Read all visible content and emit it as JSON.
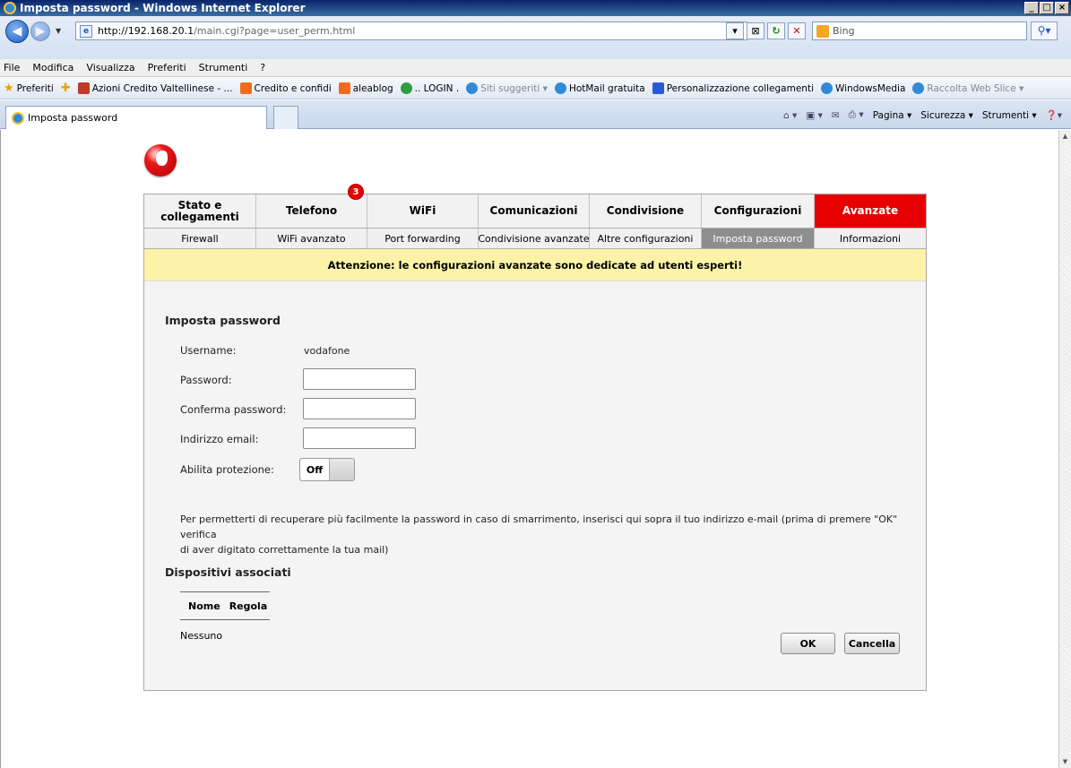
{
  "window": {
    "title": "Imposta password - Windows Internet Explorer",
    "controls": [
      "_",
      "□",
      "×"
    ]
  },
  "address": {
    "host": "http://192.168.20.1",
    "path": "/main.cgi?page=user_perm.html",
    "search_placeholder": "Bing"
  },
  "menu": [
    "File",
    "Modifica",
    "Visualizza",
    "Preferiti",
    "Strumenti",
    "?"
  ],
  "favorites": {
    "label": "Preferiti",
    "items": [
      {
        "label": "Azioni Credito Valtellinese - ...",
        "color": "#c0392b"
      },
      {
        "label": "Credito e confidi",
        "color": "#f26b1d"
      },
      {
        "label": "aleablog",
        "color": "#f26b1d"
      },
      {
        "label": ".. LOGIN .",
        "color": "#2e9e3e"
      },
      {
        "label": "Siti suggeriti ▾",
        "color": "#2f8bd8"
      },
      {
        "label": "HotMail gratuita",
        "color": "#2f8bd8"
      },
      {
        "label": "Personalizzazione collegamenti",
        "color": "#2a5bd7"
      },
      {
        "label": "WindowsMedia",
        "color": "#2f8bd8"
      },
      {
        "label": "Raccolta Web Slice ▾",
        "color": "#2f8bd8"
      }
    ]
  },
  "tab": {
    "label": "Imposta password"
  },
  "commands": {
    "pagina": "Pagina ▾",
    "sicurezza": "Sicurezza ▾",
    "strumenti": "Strumenti ▾"
  },
  "router": {
    "main_tabs": [
      "Stato e collegamenti",
      "Telefono",
      "WiFi",
      "Comunicazioni",
      "Condivisione",
      "Configurazioni",
      "Avanzate"
    ],
    "badge": "3",
    "sub_tabs": [
      "Firewall",
      "WiFi avanzato",
      "Port forwarding",
      "Condivisione avanzate",
      "Altre configurazioni",
      "Imposta password",
      "Informazioni"
    ],
    "warning": "Attenzione: le configurazioni avanzate sono dedicate ad utenti esperti!",
    "section_title": "Imposta password",
    "username_label": "Username:",
    "username_value": "vodafone",
    "password_label": "Password:",
    "confirm_label": "Conferma password:",
    "email_label": "Indirizzo email:",
    "protection_label": "Abilita protezione:",
    "protection_value": "Off",
    "note_line1": "Per permetterti di recuperare più facilmente la password in caso di smarrimento, inserisci qui sopra il tuo indirizzo e-mail (prima di premere \"OK\" verifica",
    "note_line2": "di aver digitato correttamente la tua mail)",
    "devices_title": "Dispositivi associati",
    "col_name": "Nome",
    "col_rule": "Regola",
    "no_devices": "Nessuno",
    "ok": "OK",
    "cancel": "Cancella",
    "accent": "#e60000"
  }
}
